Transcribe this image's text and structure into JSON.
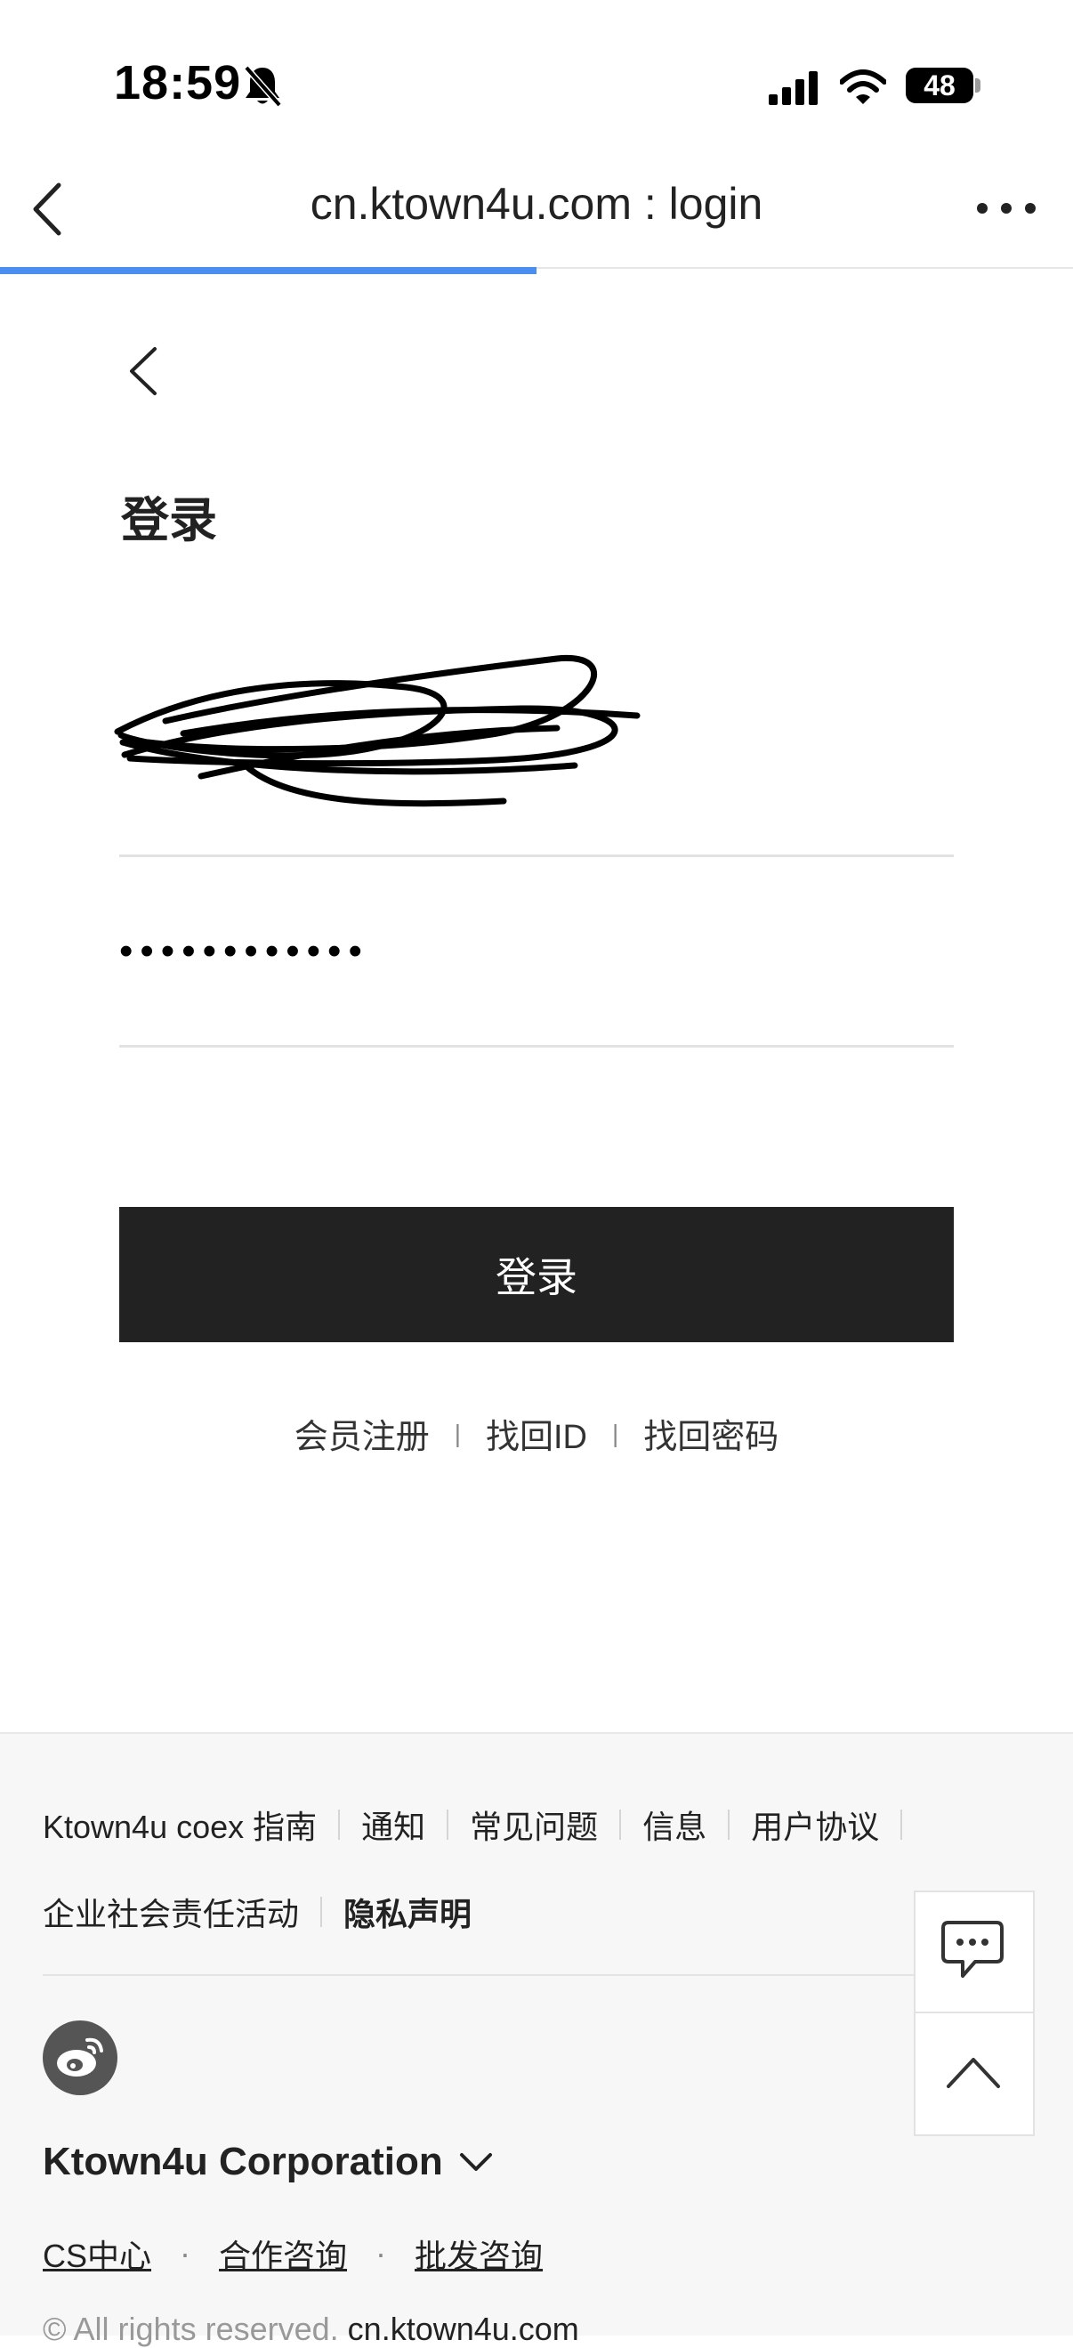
{
  "status_bar": {
    "time": "18:59",
    "battery": "48",
    "icons": [
      "bell-slash-icon",
      "cellular-signal-icon",
      "wifi-icon",
      "battery-icon"
    ]
  },
  "browser": {
    "title": "cn.ktown4u.com : login",
    "load_progress": 0.5,
    "accent_color": "#4a8ff0",
    "icons": [
      "chevron-left-icon",
      "more-horizontal-icon"
    ]
  },
  "login": {
    "heading": "登录",
    "id_value": "",
    "password_value": "••••••••••••",
    "submit_label": "登录",
    "button_color": "#222222",
    "links": {
      "register": "会员注册",
      "find_id": "找回ID",
      "find_password": "找回密码",
      "separator": "|"
    }
  },
  "footer": {
    "links_row1": [
      "Ktown4u coex 指南",
      "通知",
      "常见问题",
      "信息",
      "用户协议"
    ],
    "links_row2": [
      "企业社会责任活动",
      "隐私声明"
    ],
    "company": "Ktown4u Corporation",
    "cs_links": [
      "CS中心",
      "合作咨询",
      "批发咨询"
    ],
    "cs_separator": "·",
    "copyright_text": "© All rights reserved.",
    "copyright_site": "cn.ktown4u.com",
    "icons": [
      "weibo-icon",
      "chevron-down-icon",
      "chat-bubble-icon",
      "chevron-up-icon"
    ]
  }
}
